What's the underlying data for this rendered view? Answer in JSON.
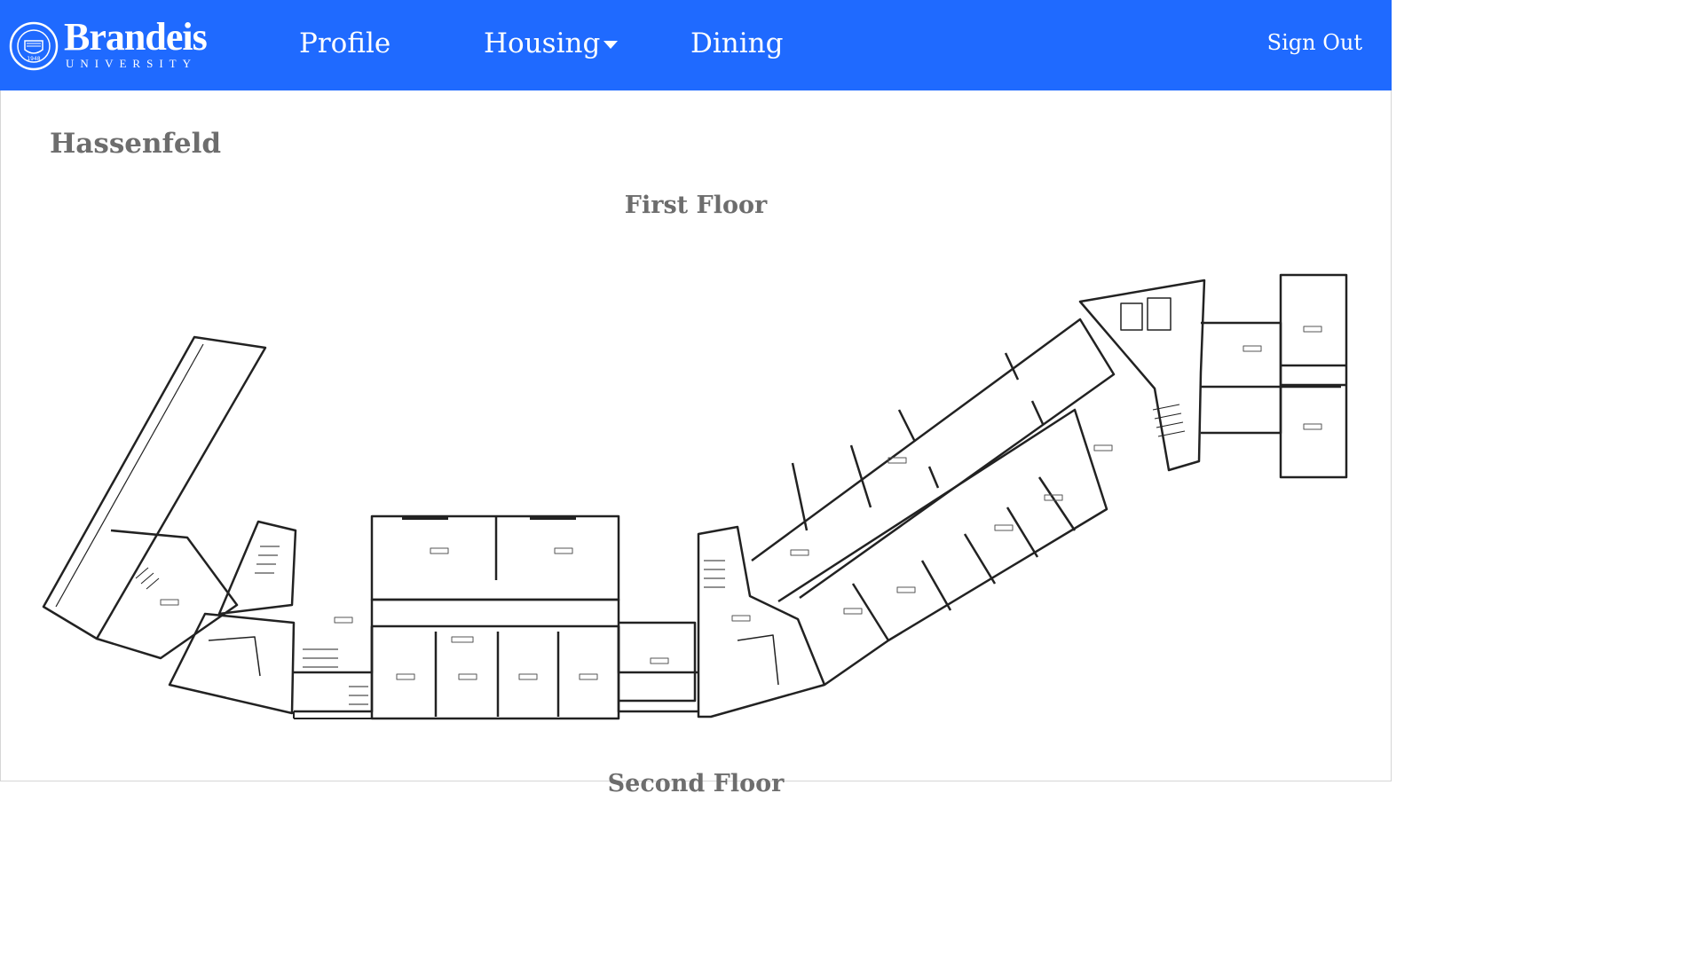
{
  "navbar": {
    "brand": {
      "name": "Brandeis",
      "sub": "UNIVERSITY"
    },
    "items": [
      {
        "label": "Profile"
      },
      {
        "label": "Housing",
        "has_dropdown": true
      },
      {
        "label": "Dining"
      }
    ],
    "sign_out": "Sign Out",
    "color": "#1f6aff"
  },
  "page": {
    "building": "Hassenfeld",
    "floors": [
      {
        "title": "First Floor"
      },
      {
        "title": "Second Floor"
      }
    ]
  }
}
